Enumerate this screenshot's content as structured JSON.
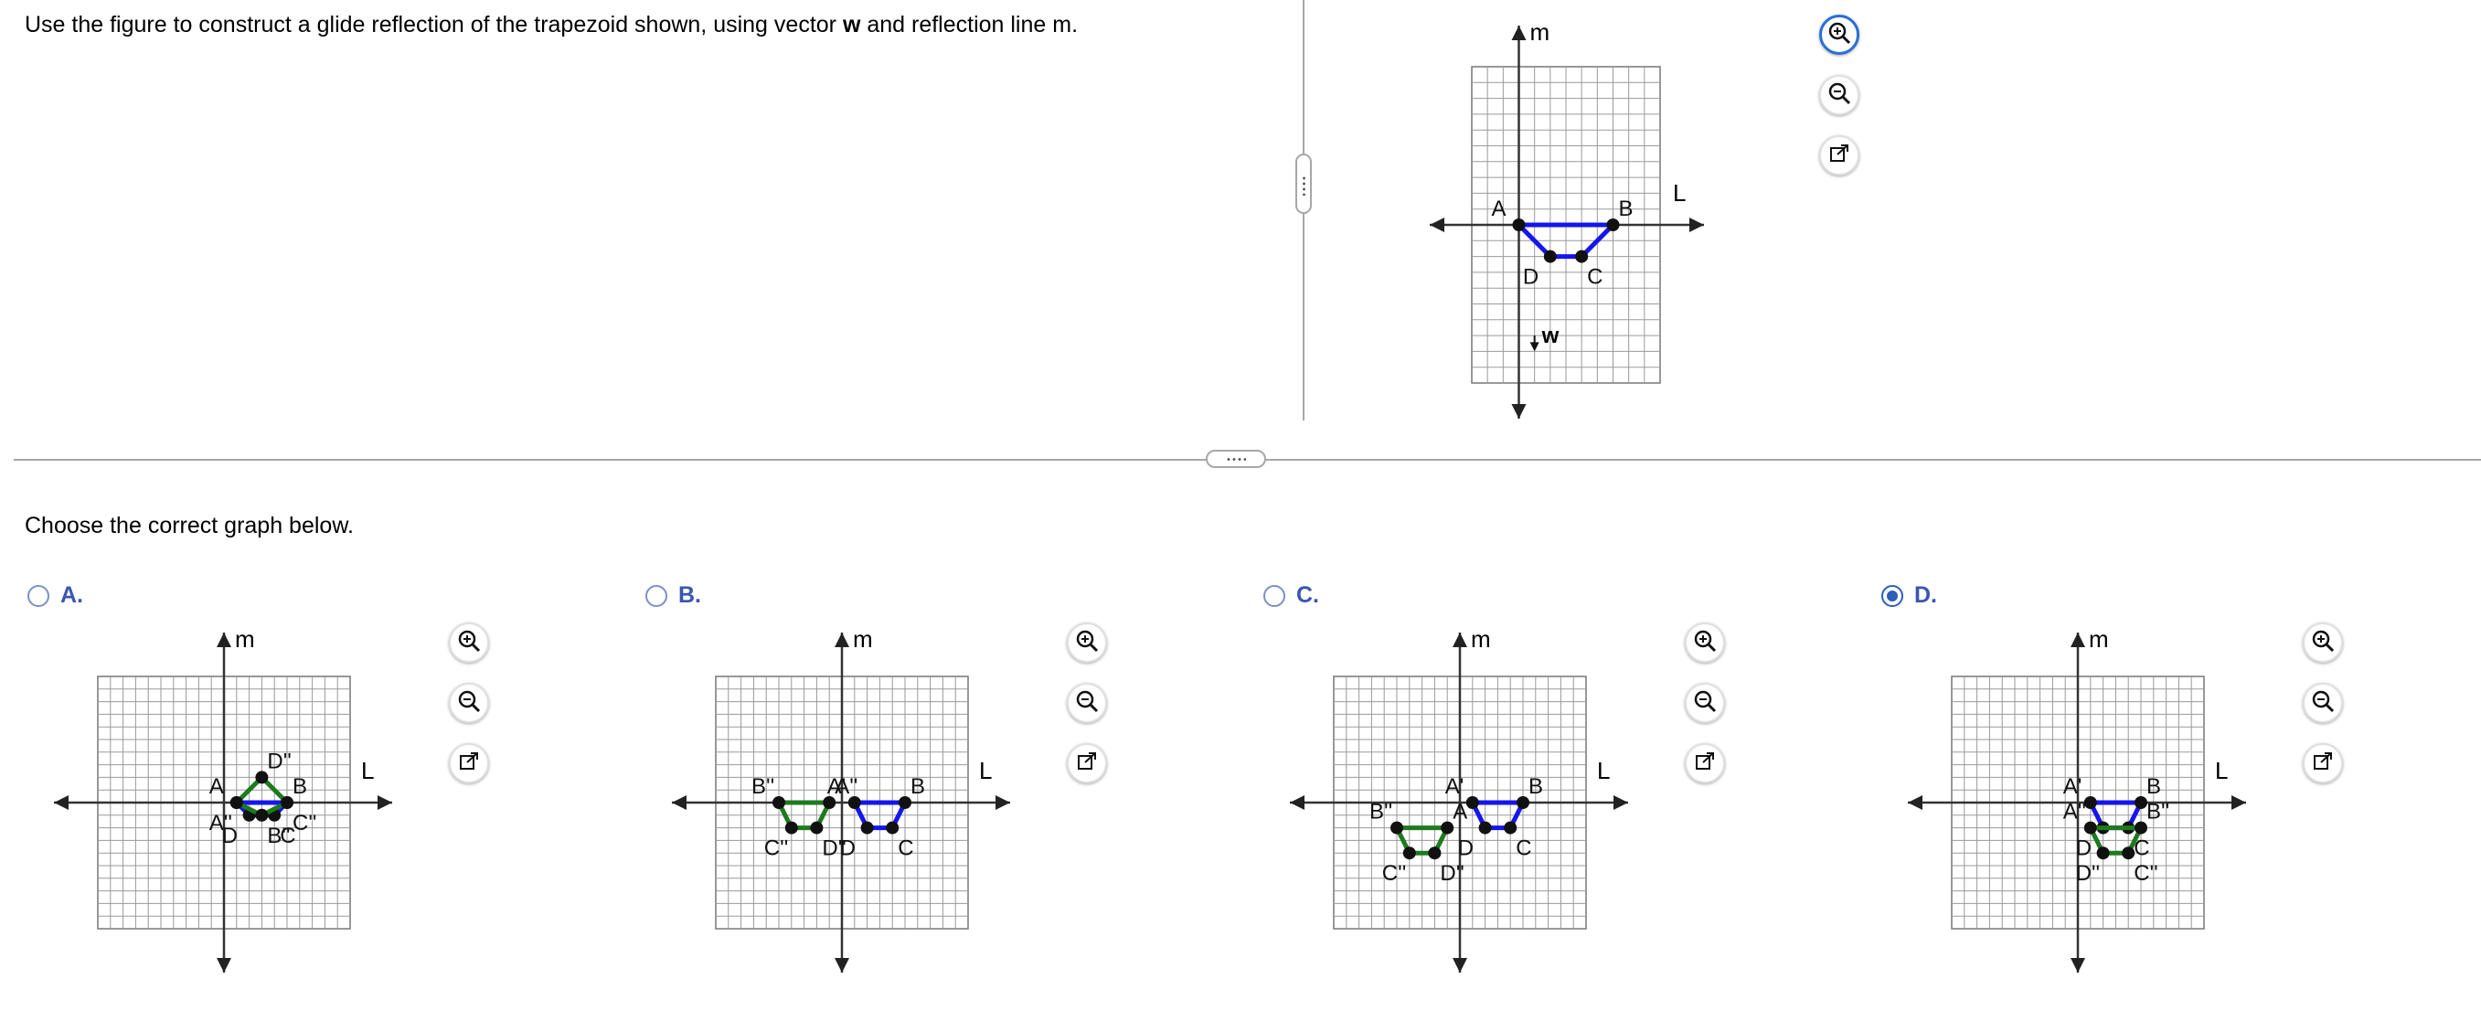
{
  "question": {
    "text_before": "Use the figure to construct a glide reflection of the trapezoid shown, using vector ",
    "vector_name": "w",
    "text_after": " and reflection line m."
  },
  "choose_prompt": "Choose the correct graph below.",
  "options": [
    {
      "letter": "A.",
      "selected": false
    },
    {
      "letter": "B.",
      "selected": false
    },
    {
      "letter": "C.",
      "selected": false
    },
    {
      "letter": "D.",
      "selected": true
    }
  ],
  "icons": {
    "zoom_in": "zoom-in-icon",
    "zoom_out": "zoom-out-icon",
    "popout": "popout-icon"
  },
  "colors": {
    "blue": "#1515ee",
    "green": "#1e7a1e",
    "option_label": "#3a56b0",
    "radio_selected": "#2f5db8"
  },
  "chart_data": [
    {
      "type": "scatter",
      "role": "question",
      "grid": true,
      "axes": {
        "vertical_label": "m",
        "horizontal_label": "L"
      },
      "points": [
        {
          "label": "A",
          "x": 0,
          "y": 0
        },
        {
          "label": "B",
          "x": 6,
          "y": 0
        },
        {
          "label": "C",
          "x": 4,
          "y": -2
        },
        {
          "label": "D",
          "x": 2,
          "y": -2
        }
      ],
      "vector": {
        "label": "w",
        "from": [
          1,
          -7
        ],
        "to": [
          1,
          -8
        ]
      }
    },
    {
      "type": "scatter",
      "role": "option A",
      "grid": true,
      "axes": {
        "vertical_label": "m",
        "horizontal_label": "L"
      },
      "blue": [
        {
          "label": "A",
          "x": 1,
          "y": 0
        },
        {
          "label": "B",
          "x": 5,
          "y": 0
        },
        {
          "label": "C",
          "x": 4,
          "y": -1
        },
        {
          "label": "D",
          "x": 2,
          "y": -1
        }
      ],
      "green": [
        {
          "label": "A''",
          "x": 1,
          "y": 0
        },
        {
          "label": "B''",
          "x": 3,
          "y": -1
        },
        {
          "label": "C''",
          "x": 5,
          "y": 0
        },
        {
          "label": "D''",
          "x": 3,
          "y": 2
        }
      ]
    },
    {
      "type": "scatter",
      "role": "option B",
      "grid": true,
      "axes": {
        "vertical_label": "m",
        "horizontal_label": "L"
      },
      "blue": [
        {
          "label": "A'",
          "x": 1,
          "y": 0
        },
        {
          "label": "B",
          "x": 5,
          "y": 0
        },
        {
          "label": "C",
          "x": 4,
          "y": -2
        },
        {
          "label": "D",
          "x": 2,
          "y": -2
        }
      ],
      "green": [
        {
          "label": "A''",
          "x": -1,
          "y": 0
        },
        {
          "label": "B''",
          "x": -5,
          "y": 0
        },
        {
          "label": "C''",
          "x": -4,
          "y": -2
        },
        {
          "label": "D''",
          "x": -2,
          "y": -2
        }
      ]
    },
    {
      "type": "scatter",
      "role": "option C",
      "grid": true,
      "axes": {
        "vertical_label": "m",
        "horizontal_label": "L"
      },
      "blue": [
        {
          "label": "A'",
          "x": 1,
          "y": 0
        },
        {
          "label": "B",
          "x": 5,
          "y": 0
        },
        {
          "label": "C",
          "x": 4,
          "y": -2
        },
        {
          "label": "D",
          "x": 2,
          "y": -2
        }
      ],
      "green": [
        {
          "label": "A''",
          "x": -1,
          "y": -2
        },
        {
          "label": "B''",
          "x": -5,
          "y": -2
        },
        {
          "label": "C''",
          "x": -4,
          "y": -4
        },
        {
          "label": "D''",
          "x": -2,
          "y": -4
        }
      ]
    },
    {
      "type": "scatter",
      "role": "option D",
      "grid": true,
      "axes": {
        "vertical_label": "m",
        "horizontal_label": "L"
      },
      "blue": [
        {
          "label": "A'",
          "x": 1,
          "y": 0
        },
        {
          "label": "B",
          "x": 5,
          "y": 0
        },
        {
          "label": "C",
          "x": 4,
          "y": -2
        },
        {
          "label": "D",
          "x": 2,
          "y": -2
        }
      ],
      "green": [
        {
          "label": "A''",
          "x": 1,
          "y": -2
        },
        {
          "label": "B''",
          "x": 5,
          "y": -2
        },
        {
          "label": "C''",
          "x": 4,
          "y": -4
        },
        {
          "label": "D''",
          "x": 2,
          "y": -4
        }
      ]
    }
  ]
}
